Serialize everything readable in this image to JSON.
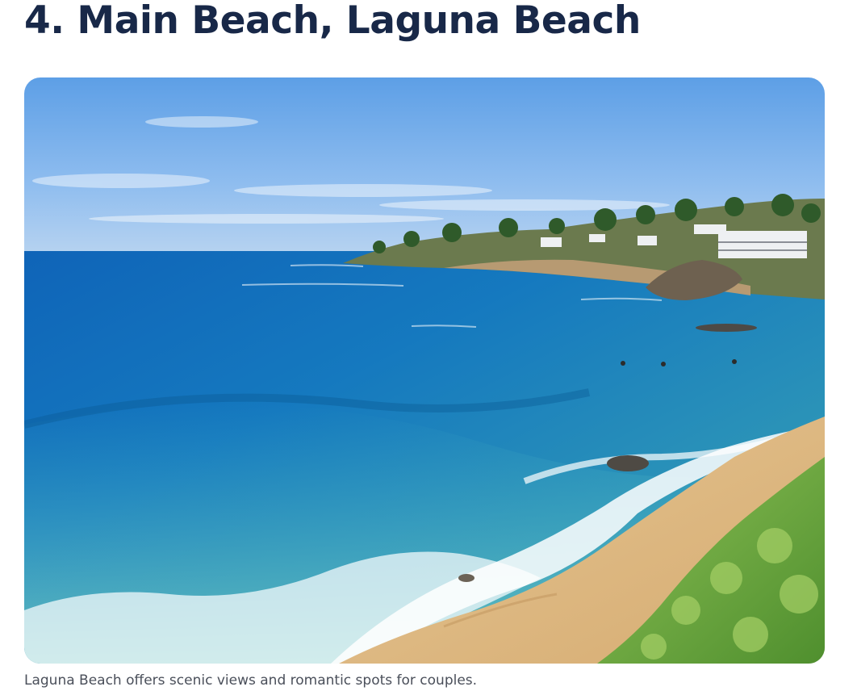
{
  "article": {
    "heading": "4. Main Beach, Laguna Beach",
    "image_alt": "Laguna Beach coastline with turquoise water, waves rolling onto a sandy beach, and cliffside homes",
    "caption": "Laguna Beach offers scenic views and romantic spots for couples."
  }
}
